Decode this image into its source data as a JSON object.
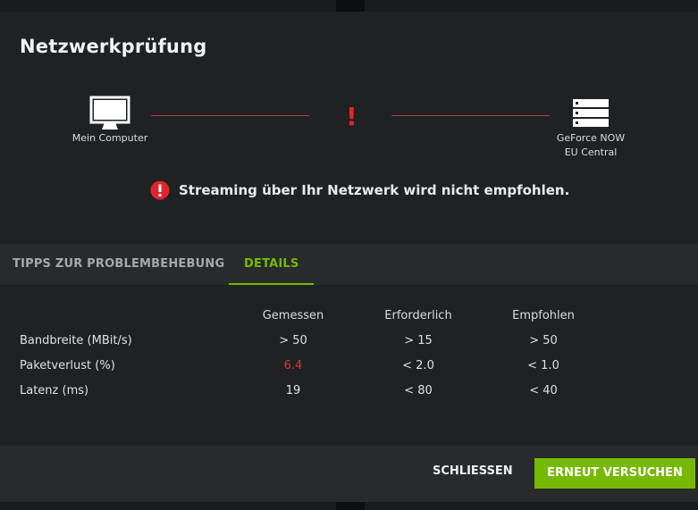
{
  "dialog": {
    "title": "Netzwerkprüfung",
    "diagram": {
      "local_label": "Mein Computer",
      "server_label_line1": "GeForce NOW",
      "server_label_line2": "EU Central",
      "status_mark": "!",
      "local_icon": "monitor-icon",
      "server_icon": "server-icon",
      "alert_icon": "exclamation-icon"
    },
    "warning": {
      "icon": "error-circle-icon",
      "text": "Streaming über Ihr Netzwerk wird nicht empfohlen."
    },
    "tabs": [
      {
        "label": "TIPPS ZUR PROBLEMBEHEBUNG",
        "active": false
      },
      {
        "label": "DETAILS",
        "active": true
      }
    ],
    "table": {
      "headers": [
        "Gemessen",
        "Erforderlich",
        "Empfohlen"
      ],
      "rows": [
        {
          "label": "Bandbreite (MBit/s)",
          "measured": "> 50",
          "required": "> 15",
          "recommended": "> 50"
        },
        {
          "label": "Paketverlust (%)",
          "measured": "6.4",
          "required": "< 2.0",
          "recommended": "< 1.0"
        },
        {
          "label": "Latenz (ms)",
          "measured": "19",
          "required": "< 80",
          "recommended": "< 40"
        }
      ]
    },
    "buttons": {
      "close_label": "SCHLIESSEN",
      "retry_label": "ERNEUT VERSUCHEN"
    }
  },
  "colors": {
    "accent": "#76b900",
    "error": "#e0242b",
    "dialog_bg": "#1f2123",
    "panel_bg": "#282a2c"
  }
}
